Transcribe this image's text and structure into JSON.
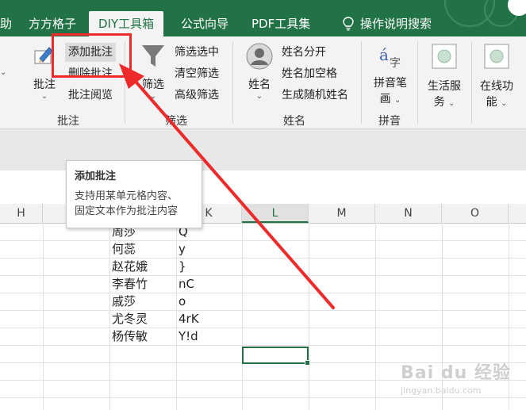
{
  "tabs": {
    "partial": "助",
    "ffgz": "方方格子",
    "diy": "DIY工具箱",
    "gsxd": "公式向导",
    "pdf": "PDF工具集",
    "search": "操作说明搜索"
  },
  "ribbon": {
    "comment_group": {
      "big_label": "批注",
      "add": "添加批注",
      "delete": "删除批注",
      "read": "批注阅览",
      "group_label": "批注"
    },
    "filter_group": {
      "big_label": "筛选",
      "filter_selected": "筛选选中",
      "clear_filter": "清空筛选",
      "advanced_filter": "高级筛选",
      "group_label": "筛选"
    },
    "name_group": {
      "big_label": "姓名",
      "split_name": "姓名分开",
      "name_space": "姓名加空格",
      "random_name": "生成随机姓名",
      "group_label": "姓名"
    },
    "pinyin_group": {
      "big_label_1": "拼音笔",
      "big_label_2": "画",
      "group_label": "拼音"
    },
    "life_service": {
      "label_1": "生活服",
      "label_2": "务"
    },
    "online_func": {
      "label_1": "在线功",
      "label_2": "能"
    }
  },
  "tooltip": {
    "title": "添加批注",
    "body_line1": "支持用某单元格内容、",
    "body_line2": "固定文本作为批注内容"
  },
  "columns": [
    "H",
    "I",
    "J",
    "K",
    "L",
    "M",
    "N",
    "O"
  ],
  "selected_column": "L",
  "rows": [
    {
      "name": "周莎",
      "value": "Q"
    },
    {
      "name": "何蕊",
      "value": "y"
    },
    {
      "name": "赵花娥",
      "value": "}"
    },
    {
      "name": "李春竹",
      "value": "nC"
    },
    {
      "name": "戚莎",
      "value": "o"
    },
    {
      "name": "尤冬灵",
      "value": "4rK"
    },
    {
      "name": "杨传敏",
      "value": "Y!d"
    }
  ],
  "watermark": {
    "logo": "Bai du 经验",
    "url": "jingyan.baidu.com"
  },
  "colors": {
    "accent": "#217346",
    "annotation_red": "#ee2a2a"
  }
}
